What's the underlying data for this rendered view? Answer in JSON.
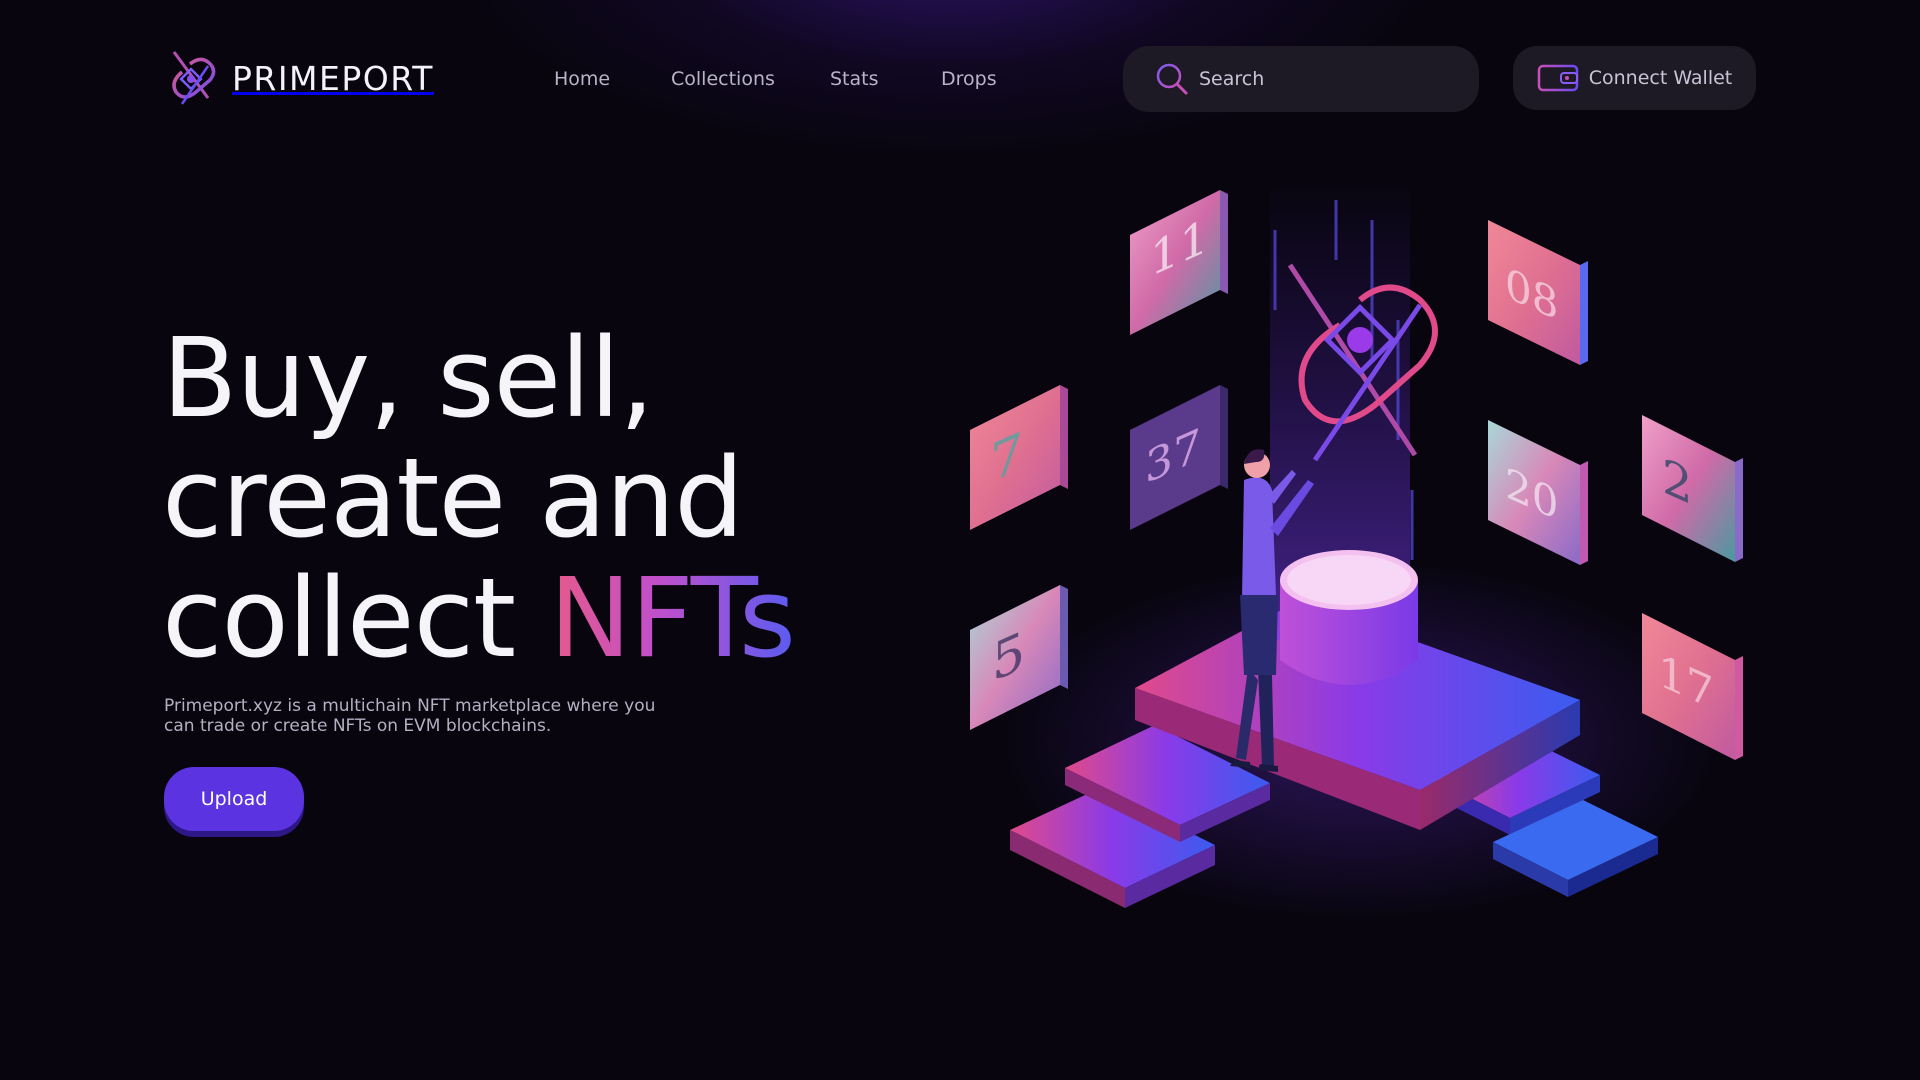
{
  "brand": {
    "name": "PRIMEPORT"
  },
  "nav": {
    "items": [
      {
        "label": "Home"
      },
      {
        "label": "Collections"
      },
      {
        "label": "Stats"
      },
      {
        "label": "Drops"
      }
    ]
  },
  "search": {
    "placeholder": "Search"
  },
  "wallet": {
    "label": "Connect Wallet"
  },
  "hero": {
    "title_line1": "Buy, sell,",
    "title_line2": "create and",
    "title_line3_prefix": "collect ",
    "title_highlight": "NFTs",
    "description": "Primeport.xyz is a multichain NFT marketplace where you can trade or create NFTs on EVM blockchains.",
    "upload_label": "Upload"
  },
  "illustration": {
    "cards": [
      {
        "number": "11"
      },
      {
        "number": "7"
      },
      {
        "number": "37"
      },
      {
        "number": "5"
      },
      {
        "number": "08"
      },
      {
        "number": "20"
      },
      {
        "number": "2"
      },
      {
        "number": "17"
      }
    ]
  },
  "colors": {
    "background": "#08050f",
    "accent": "#5b33e0",
    "gradient_start": "#e65a8a",
    "gradient_end": "#5a5cf0"
  }
}
